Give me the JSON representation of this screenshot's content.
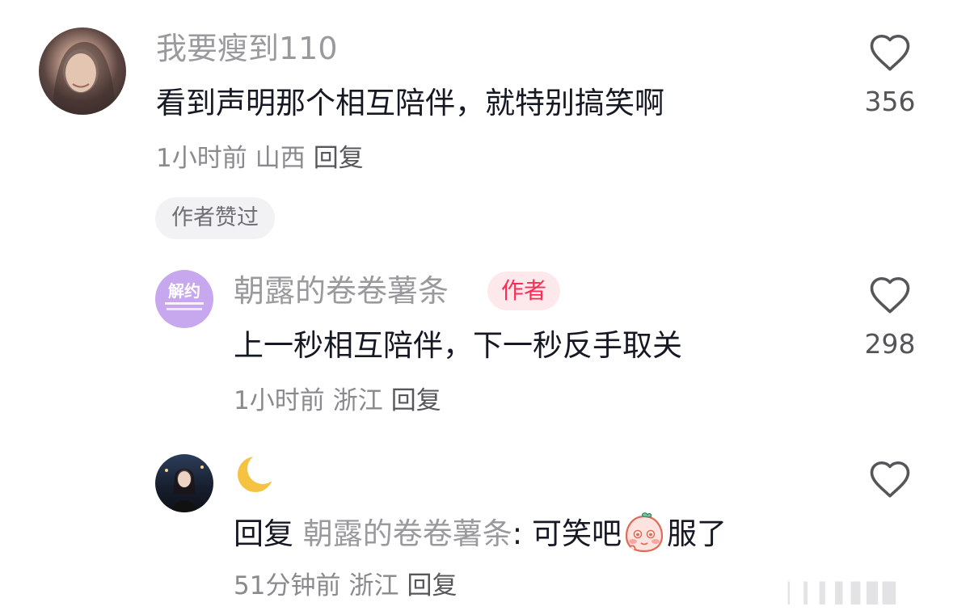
{
  "comments": [
    {
      "username": "我要瘦到110",
      "text": "看到声明那个相互陪伴，就特别搞笑啊",
      "time": "1小时前",
      "location": "山西",
      "reply_label": "回复",
      "like_count": "356",
      "chip": "作者赞过"
    },
    {
      "username": "朝露的卷卷薯条",
      "badge": "作者",
      "avatar_text": "解约",
      "text": "上一秒相互陪伴，下一秒反手取关",
      "time": "1小时前",
      "location": "浙江",
      "reply_label": "回复",
      "like_count": "298"
    },
    {
      "username": "🌙",
      "reply_prefix": "回复",
      "reply_to": "朝露的卷卷薯条",
      "text_after": ": 可笑吧",
      "text_tail": "服了",
      "time": "51分钟前",
      "location": "浙江",
      "reply_label": "回复",
      "like_count": ""
    }
  ],
  "watermark": "▏▎▍▌▋▊▉",
  "icons": {
    "like": "heart-outline-icon",
    "moon": "crescent-moon-emoji",
    "emoji": "blushing-peach-emoji"
  },
  "colors": {
    "author_badge_bg": "#fde9ec",
    "author_badge_text": "#fe2c55",
    "username": "#9a9a9e",
    "avatar_purple": "#c7a8ef"
  }
}
